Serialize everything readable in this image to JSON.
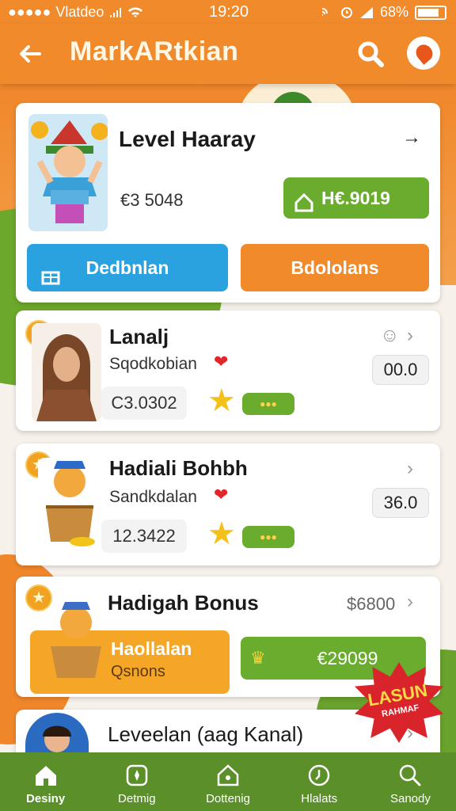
{
  "status_bar": {
    "carrier": "Vlatdeo",
    "time": "19:20",
    "battery": "68%"
  },
  "header": {
    "title": "MarkARtkian"
  },
  "cards": [
    {
      "title": "Level Haaray",
      "value": "€3 5048",
      "green_button": "H€.9019",
      "blue_button": "Dedbnlan",
      "orange_button": "Bdololans"
    },
    {
      "title": "Lanalj",
      "subtitle": "Sqodkobian",
      "value": "C3.0302",
      "score": "00.0"
    },
    {
      "title": "Hadiali Bohbh",
      "subtitle": "Sandkdalan",
      "value": "12.3422",
      "score": "36.0"
    },
    {
      "title": "Hadigah Bonus",
      "price": "$6800",
      "orange_label": "Haollalan",
      "orange_sub": "Qsnons",
      "green_value": "€29099"
    },
    {
      "title": "Leveelan (aag Kanal)"
    }
  ],
  "burst": {
    "title": "LASUN",
    "sub": "RAHMAF"
  },
  "nav": [
    {
      "label": "Desiny",
      "icon": "home-icon"
    },
    {
      "label": "Detmig",
      "icon": "compass-icon"
    },
    {
      "label": "Dottenig",
      "icon": "house-icon"
    },
    {
      "label": "Hlalats",
      "icon": "clock-icon"
    },
    {
      "label": "Sanody",
      "icon": "search-icon"
    }
  ],
  "colors": {
    "primary_orange": "#f08a2b",
    "green": "#6aac2e",
    "blue": "#2ba2e0",
    "nav_green": "#5a8f2a"
  }
}
